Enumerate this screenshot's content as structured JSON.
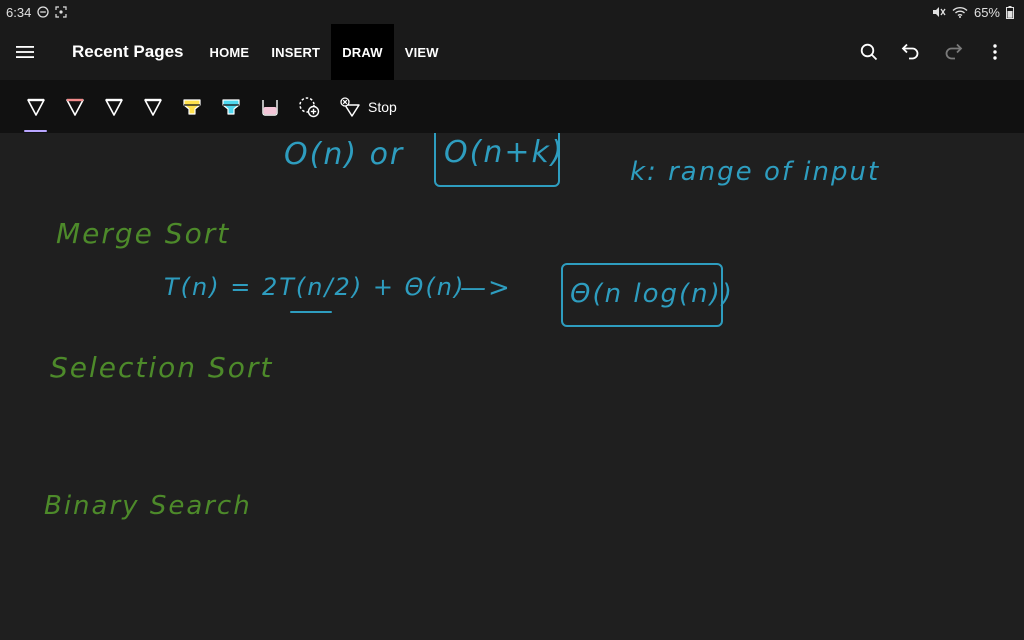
{
  "status": {
    "time": "6:34",
    "battery": "65%"
  },
  "header": {
    "title": "Recent Pages",
    "tabs": [
      {
        "label": "HOME",
        "active": false
      },
      {
        "label": "INSERT",
        "active": false
      },
      {
        "label": "DRAW",
        "active": true
      },
      {
        "label": "VIEW",
        "active": false
      }
    ],
    "actions": [
      "search-icon",
      "undo-icon",
      "redo-icon",
      "more-vert-icon"
    ]
  },
  "toolbar": {
    "tools": [
      {
        "name": "pen-white",
        "color": "#ffffff"
      },
      {
        "name": "pen-red",
        "color": "#f28b8b"
      },
      {
        "name": "pen-white-2",
        "color": "#ffffff"
      },
      {
        "name": "pen-white-3",
        "color": "#ffffff"
      },
      {
        "name": "highlighter-yellow",
        "color": "#ffe14d"
      },
      {
        "name": "highlighter-cyan",
        "color": "#4fd8f0"
      },
      {
        "name": "highlighter-pink",
        "color": "#f4c6d8"
      },
      {
        "name": "lasso-add",
        "color": "#ffffff"
      }
    ],
    "stop_label": "Stop"
  },
  "canvas": {
    "ink_color_green": "#4d8a2a",
    "ink_color_blue": "#2e9dbf",
    "notes": {
      "line1_a": "O(n) or",
      "line1_b": "O(n+k)",
      "line1_c": "k: range of input",
      "merge_sort": "Merge Sort",
      "recurrence": "T(n) = 2T(n/2) + Θ(n)",
      "arrow": "—>",
      "merge_result": "Θ(n log(n))",
      "selection_sort": "Selection Sort",
      "binary_search": "Binary Search"
    }
  }
}
